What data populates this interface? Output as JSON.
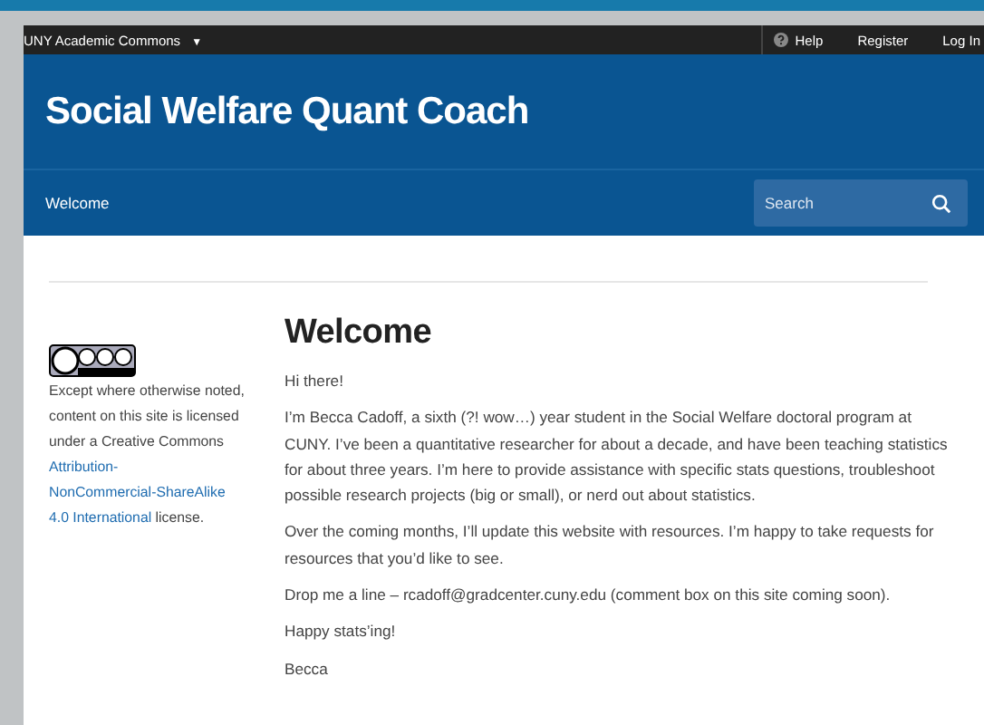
{
  "admin_bar": {
    "site_menu": "UNY Academic Commons",
    "caret": "▼",
    "links": [
      {
        "label": "Help",
        "kind": "help"
      },
      {
        "label": "Register",
        "kind": "plain"
      },
      {
        "label": "Log In",
        "kind": "plain"
      }
    ]
  },
  "header": {
    "title": "Social Welfare Quant Coach"
  },
  "nav": {
    "items": [
      {
        "label": "Welcome",
        "selected": true
      }
    ],
    "search": {
      "placeholder": "Search"
    }
  },
  "sidebar": {
    "text_before": "Except where otherwise noted, content on this site is licensed under a Creative Commons ",
    "link_lines": [
      "Attribution-",
      "NonCommercial-ShareAlike",
      "4.0 International"
    ],
    "text_after": " license."
  },
  "page": {
    "heading": "Welcome",
    "paragraphs": [
      "Hi there!",
      "I’m Becca Cadoff, a sixth (?! wow…) year student in the Social Welfare doctoral program at CUNY. I’ve been a quantitative researcher for about a decade, and have been teaching statistics for about three years. I’m here to provide assistance with specific stats questions, troubleshoot possible research projects (big or small), or nerd out about statistics.",
      "Over the coming months, I’ll update this website with resources. I’m happy to take requests for resources that you’d like to see.",
      "Drop me a line – rcadoff@gradcenter.cuny.edu (comment box on this site coming soon).",
      "Happy stats’ing!",
      "Becca"
    ]
  }
}
